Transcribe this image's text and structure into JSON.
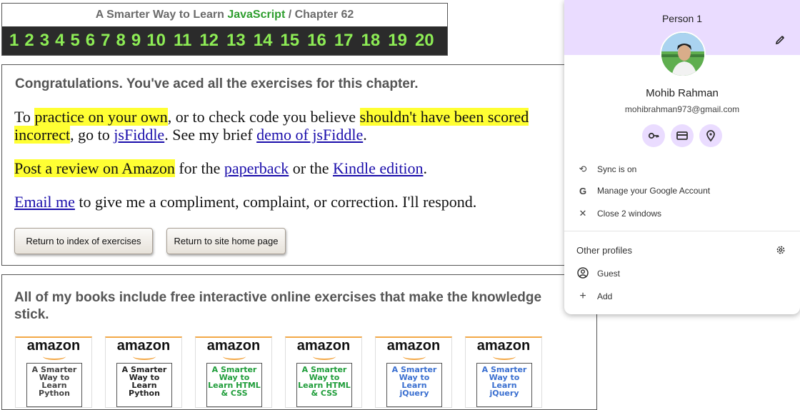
{
  "header": {
    "title_prefix": "A Smarter Way to Learn ",
    "title_js": "JavaScript",
    "title_suffix": " / Chapter 62",
    "exercises": [
      "1",
      "2",
      "3",
      "4",
      "5",
      "6",
      "7",
      "8",
      "9",
      "10",
      "11",
      "12",
      "13",
      "14",
      "15",
      "16",
      "17",
      "18",
      "19",
      "20"
    ]
  },
  "main": {
    "congrats": "Congratulations. You've aced all the exercises for this chapter.",
    "p1": {
      "t1": "To ",
      "h1": "practice on your own",
      "t2": ", or to check code you believe ",
      "h2": "shouldn't have been scored incorrect",
      "t3": ", go to ",
      "link1": "jsFiddle",
      "t4": ". See my brief ",
      "link2": "demo of jsFiddle",
      "t5": "."
    },
    "p2": {
      "h1": "Post a review on Amazon",
      "t1": " for the ",
      "link1": "paperback",
      "t2": " or the ",
      "link2": "Kindle edition",
      "t3": "."
    },
    "p3": {
      "link1": "Email me",
      "t1": " to give me a compliment, complaint, or correction. I'll respond."
    },
    "btn_index": "Return to index of exercises",
    "btn_home": "Return to site home page"
  },
  "books": {
    "title": "All of my books include free interactive online exercises that make the knowledge stick.",
    "items": [
      {
        "brand": "amazon",
        "cover": "A Smarter Way to Learn Python",
        "color": "#444444"
      },
      {
        "brand": "amazon",
        "cover": "A Smarter Way to Learn Python",
        "color": "#222222"
      },
      {
        "brand": "amazon",
        "cover": "A Smarter Way to Learn HTML & CSS",
        "color": "#1f9d3a"
      },
      {
        "brand": "amazon",
        "cover": "A Smarter Way to Learn HTML & CSS",
        "color": "#1f9d3a"
      },
      {
        "brand": "amazon",
        "cover": "A Smarter Way to Learn jQuery",
        "color": "#3a6fd0"
      },
      {
        "brand": "amazon",
        "cover": "A Smarter Way to Learn jQuery",
        "color": "#3a6fd0"
      }
    ]
  },
  "profile": {
    "person": "Person 1",
    "name": "Mohib Rahman",
    "email": "mohibrahman973@gmail.com",
    "sync": "Sync is on",
    "manage": "Manage your Google Account",
    "close": "Close 2 windows",
    "other_profiles": "Other profiles",
    "guest": "Guest",
    "add": "Add",
    "accent": "#eadcff"
  }
}
